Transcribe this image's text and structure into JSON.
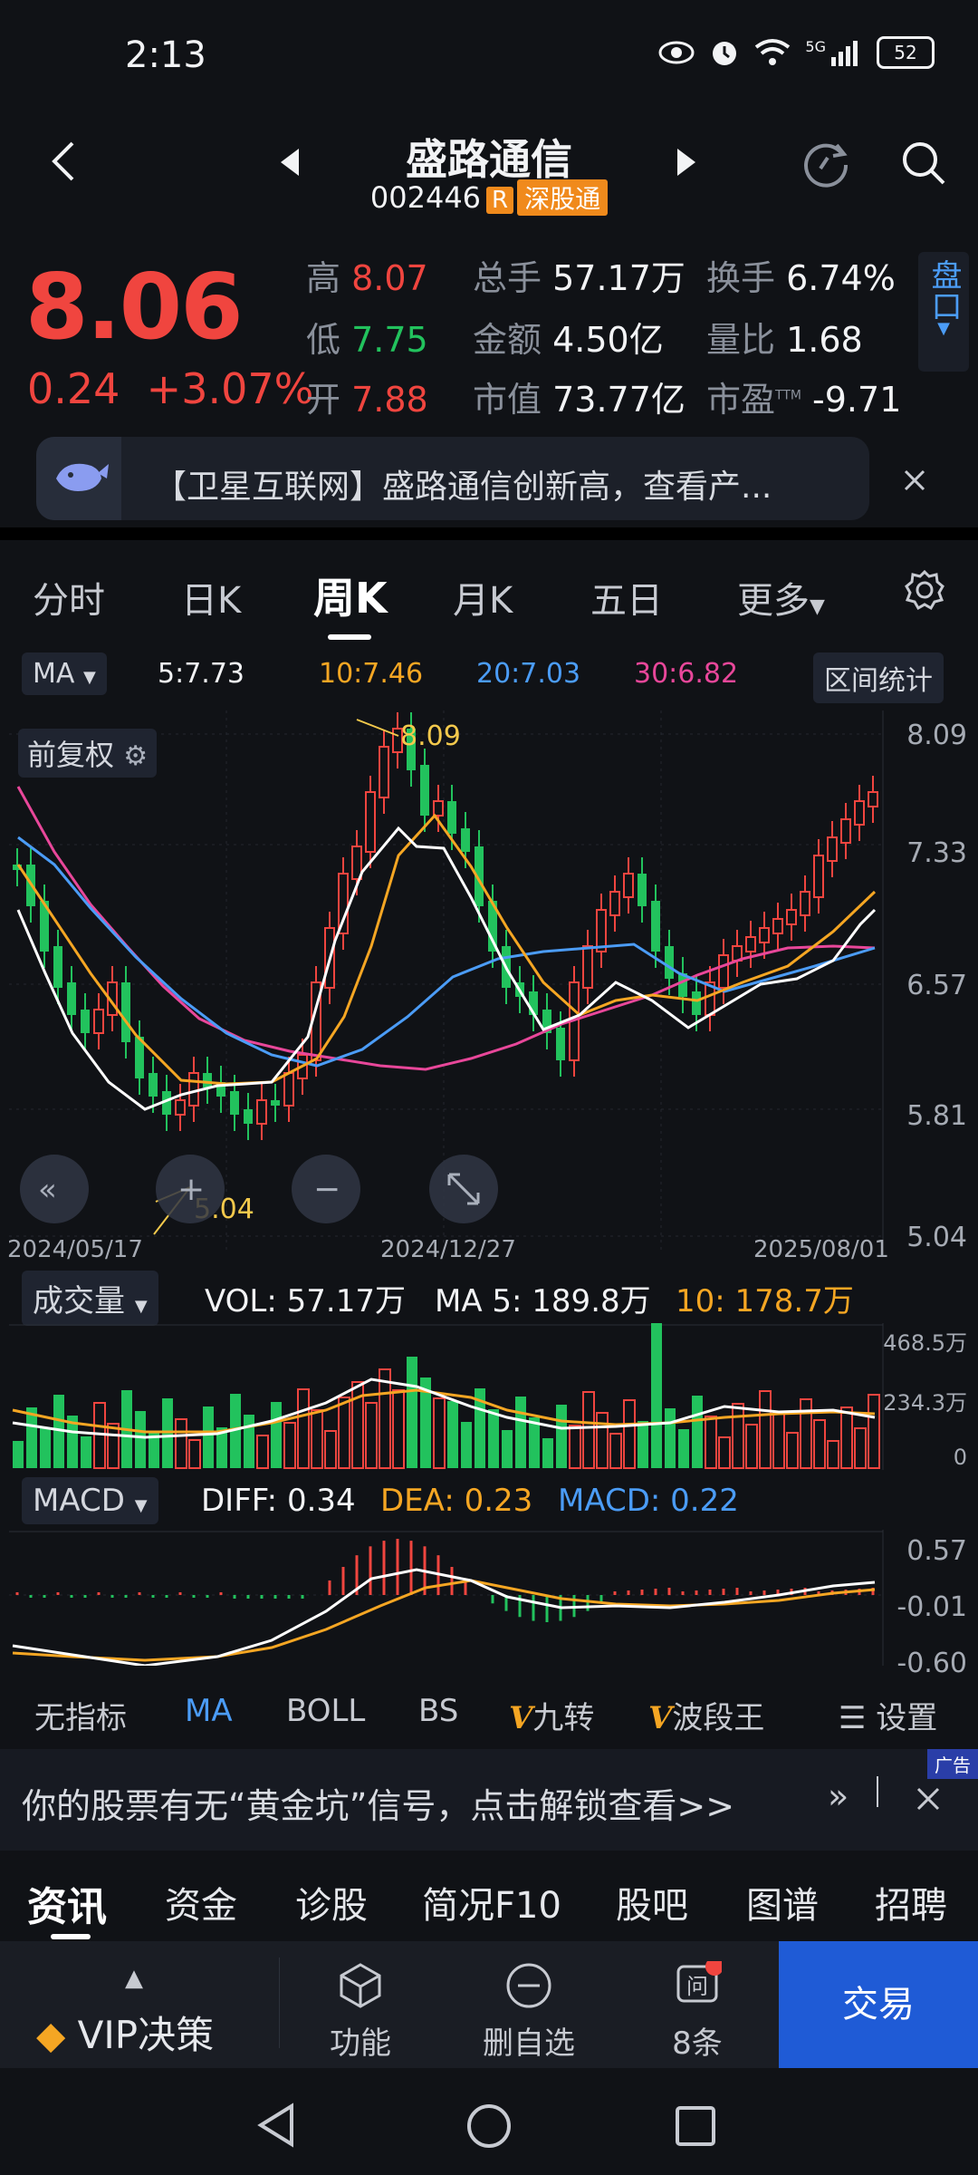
{
  "status_bar": {
    "time": "2:13",
    "battery": "52",
    "network": "5G"
  },
  "header": {
    "title": "盛路通信",
    "code": "002446",
    "tag_r": "R",
    "tag_exchange": "深股通"
  },
  "quote": {
    "price": "8.06",
    "change": "0.24",
    "change_pct": "+3.07%",
    "high_label": "高",
    "high": "8.07",
    "low_label": "低",
    "low": "7.75",
    "open_label": "开",
    "open": "7.88",
    "volume_label": "总手",
    "volume": "57.17万",
    "amount_label": "金额",
    "amount": "4.50亿",
    "mcap_label": "市值",
    "mcap": "73.77亿",
    "turnover_label": "换手",
    "turnover": "6.74%",
    "vol_ratio_label": "量比",
    "vol_ratio": "1.68",
    "pe_label": "市盈",
    "pe_sup": "TTM",
    "pe": "-9.71",
    "pankou": "盘口"
  },
  "news_banner": {
    "text": "【卫星互联网】盛路通信创新高，查看产..."
  },
  "tabs": [
    {
      "label": "分时"
    },
    {
      "label": "日K"
    },
    {
      "label": "周K"
    },
    {
      "label": "月K"
    },
    {
      "label": "五日"
    },
    {
      "label": "更多"
    }
  ],
  "ma_legend": {
    "selector": "MA",
    "ma5": "5:7.73",
    "ma10": "10:7.46",
    "ma20": "20:7.03",
    "ma30": "30:6.82",
    "range_stats": "区间统计",
    "adjust": "前复权"
  },
  "kline": {
    "y_ticks": [
      "8.09",
      "7.33",
      "6.57",
      "5.81",
      "5.04"
    ],
    "dates": [
      "2024/05/17",
      "2024/12/27",
      "2025/08/01"
    ],
    "high_mark": "8.09",
    "low_mark": "5.04"
  },
  "volume_panel": {
    "selector": "成交量",
    "vol": "VOL:  57.17万",
    "ma5": "MA 5:  189.8万",
    "ma10": "10:  178.7万",
    "ticks": [
      "468.5万",
      "234.3万",
      "0"
    ]
  },
  "macd_panel": {
    "selector": "MACD",
    "diff": "DIFF: 0.34",
    "dea": "DEA: 0.23",
    "macd": "MACD: 0.22",
    "ticks": [
      "0.57",
      "-0.01",
      "-0.60"
    ]
  },
  "indicators": [
    {
      "label": "无指标"
    },
    {
      "label": "MA"
    },
    {
      "label": "BOLL"
    },
    {
      "label": "BS"
    },
    {
      "label": "九转"
    },
    {
      "label": "波段王"
    }
  ],
  "indicator_settings": "设置",
  "ad": {
    "text": "你的股票有无“黄金坑”信号，点击解锁查看>>",
    "tag": "广告"
  },
  "info_tabs": [
    {
      "label": "资讯"
    },
    {
      "label": "资金"
    },
    {
      "label": "诊股"
    },
    {
      "label": "简况F10"
    },
    {
      "label": "股吧"
    },
    {
      "label": "图谱"
    },
    {
      "label": "招聘"
    }
  ],
  "bottom_bar": {
    "vip": "VIP决策",
    "func": "功能",
    "remove": "删自选",
    "msgs": "8条",
    "trade": "交易"
  }
}
